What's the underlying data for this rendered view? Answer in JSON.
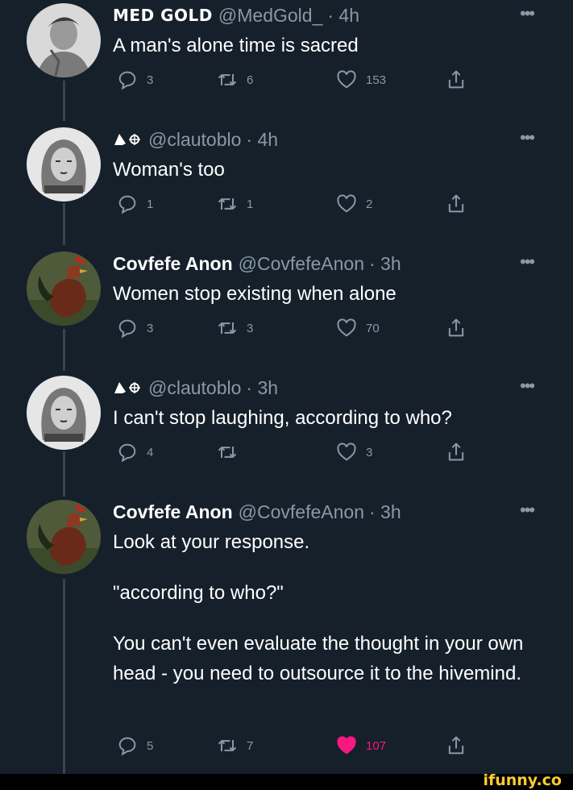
{
  "tweets": [
    {
      "name": "MED GOLD",
      "handle": "@MedGold_",
      "time": "· 4h",
      "more": "•••",
      "lines": [
        "A man's alone time is sacred"
      ],
      "replies": "3",
      "retweets": "6",
      "likes": "153",
      "liked": false
    },
    {
      "name": "",
      "handle": "@clautoblo",
      "time": "· 4h",
      "more": "•••",
      "lines": [
        "Woman's too"
      ],
      "replies": "1",
      "retweets": "1",
      "likes": "2",
      "liked": false
    },
    {
      "name": "Covfefe Anon",
      "handle": "@CovfefeAnon",
      "time": "· 3h",
      "more": "•••",
      "lines": [
        "Women stop existing when alone"
      ],
      "replies": "3",
      "retweets": "3",
      "likes": "70",
      "liked": false
    },
    {
      "name": "",
      "handle": "@clautoblo",
      "time": "· 3h",
      "more": "•••",
      "lines": [
        "I can't stop laughing, according to who?"
      ],
      "replies": "4",
      "retweets": "",
      "likes": "3",
      "liked": false
    },
    {
      "name": "Covfefe Anon",
      "handle": "@CovfefeAnon",
      "time": "· 3h",
      "more": "•••",
      "lines": [
        "Look at your response.",
        "\"according to who?\"",
        "You can't even evaluate the thought in your own head - you need to outsource it to the hivemind."
      ],
      "replies": "5",
      "retweets": "7",
      "likes": "107",
      "liked": true
    }
  ],
  "watermark": "ifunny.co",
  "colors": {
    "background": "#15202b",
    "secondary_text": "#8899a6",
    "like_active": "#f91880",
    "watermark": "#fecc2e"
  },
  "icons": [
    "reply-icon",
    "retweet-icon",
    "like-icon",
    "share-icon",
    "more-icon"
  ]
}
